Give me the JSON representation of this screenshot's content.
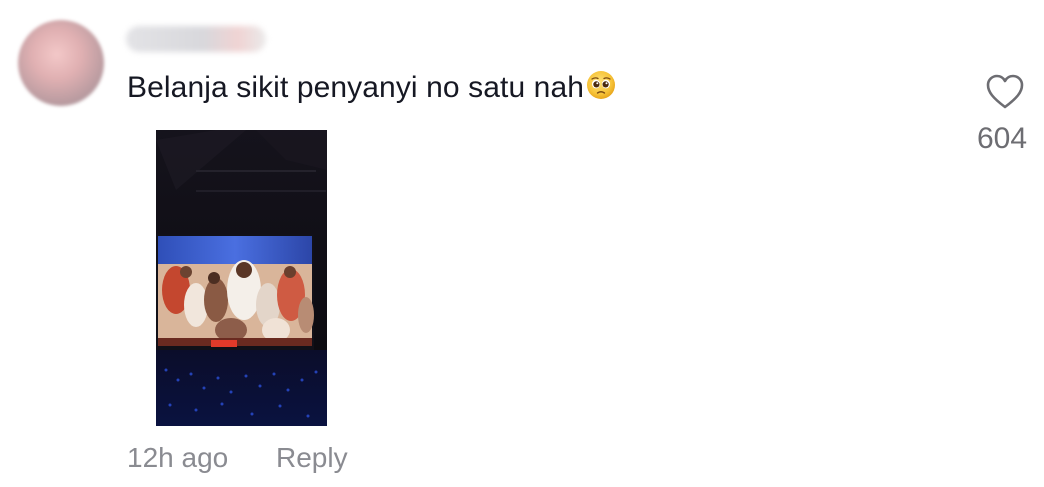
{
  "comment": {
    "text": "Belanja sikit penyanyi no satu nah",
    "emoji": "pleading-face",
    "time": "12h ago",
    "reply_label": "Reply",
    "like_count": "604"
  },
  "icons": {
    "like": "heart-outline-icon"
  },
  "colors": {
    "text": "#161823",
    "meta": "#8a8b91",
    "like_count": "#6d6d72"
  }
}
